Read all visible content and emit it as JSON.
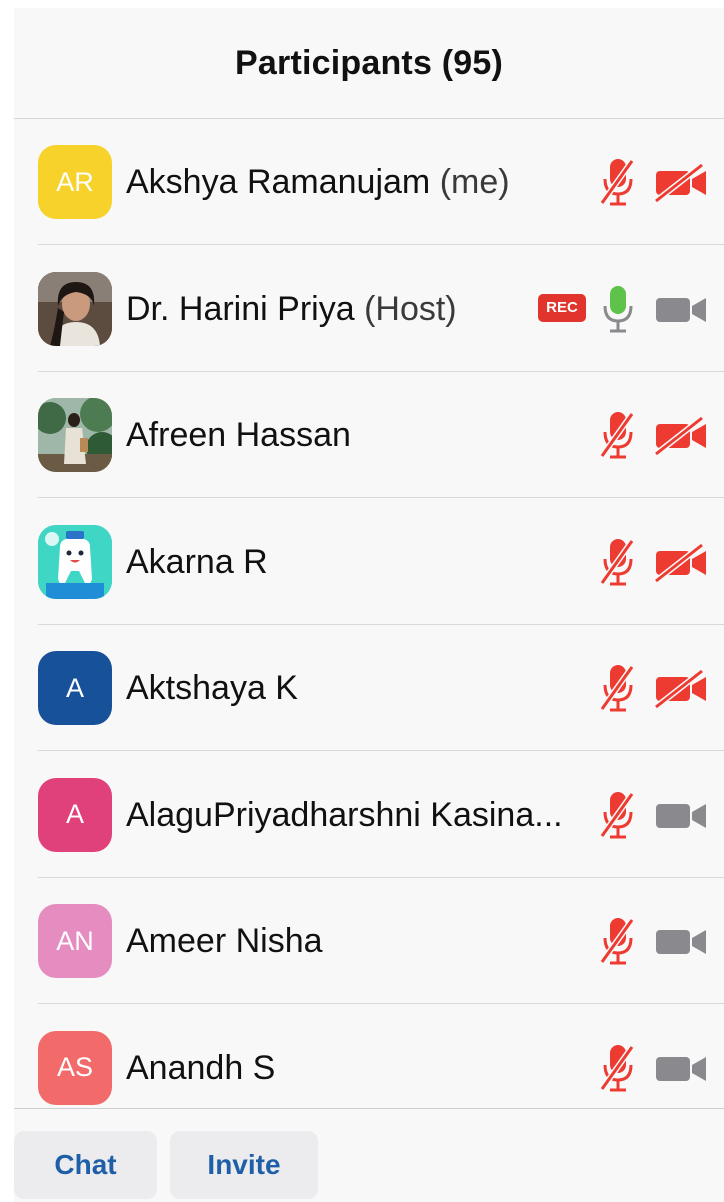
{
  "header": {
    "title": "Participants (95)"
  },
  "participants": [
    {
      "initials": "AR",
      "avatar_color": "#f7d22a",
      "avatar_type": "initials",
      "name": "Akshya Ramanujam",
      "role": "(me)",
      "recording": false,
      "mic": "muted",
      "video": "off"
    },
    {
      "initials": "",
      "avatar_color": "#6b5a4a",
      "avatar_type": "photo-person-icon",
      "name": "Dr. Harini Priya",
      "role": "(Host)",
      "recording": true,
      "rec_label": "REC",
      "mic": "on",
      "video": "on"
    },
    {
      "initials": "",
      "avatar_color": "#4c6b4a",
      "avatar_type": "photo-outdoor-icon",
      "name": "Afreen Hassan",
      "role": "",
      "recording": false,
      "mic": "muted",
      "video": "off"
    },
    {
      "initials": "",
      "avatar_color": "#3fd6c6",
      "avatar_type": "cartoon-tooth-icon",
      "name": "Akarna R",
      "role": "",
      "recording": false,
      "mic": "muted",
      "video": "off"
    },
    {
      "initials": "A",
      "avatar_color": "#17519a",
      "avatar_type": "initials",
      "name": "Aktshaya K",
      "role": "",
      "recording": false,
      "mic": "muted",
      "video": "off"
    },
    {
      "initials": "A",
      "avatar_color": "#e0417a",
      "avatar_type": "initials",
      "name": "AlaguPriyadharshni Kasina...",
      "role": "",
      "recording": false,
      "mic": "muted",
      "video": "on"
    },
    {
      "initials": "AN",
      "avatar_color": "#e58cc0",
      "avatar_type": "initials",
      "name": "Ameer Nisha",
      "role": "",
      "recording": false,
      "mic": "muted",
      "video": "on"
    },
    {
      "initials": "AS",
      "avatar_color": "#f26a6a",
      "avatar_type": "initials",
      "name": "Anandh S",
      "role": "",
      "recording": false,
      "mic": "muted",
      "video": "on"
    }
  ],
  "footer": {
    "chat_label": "Chat",
    "invite_label": "Invite"
  },
  "colors": {
    "muted_red": "#ee3b32",
    "active_green": "#5fc24a",
    "inactive_gray": "#8a8a8e",
    "link_blue": "#1f5fa8"
  }
}
